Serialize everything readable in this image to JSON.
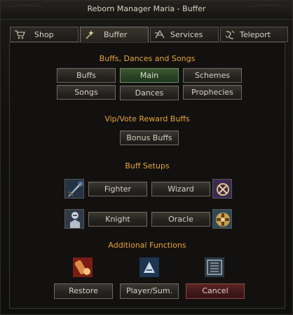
{
  "window": {
    "title": "Reborn Manager Maria - Buffer"
  },
  "tabs": [
    {
      "label": "Shop",
      "icon": "cart-icon"
    },
    {
      "label": "Buffer",
      "icon": "sparkle-icon"
    },
    {
      "label": "Services",
      "icon": "services-icon"
    },
    {
      "label": "Teleport",
      "icon": "teleport-icon"
    }
  ],
  "sections": {
    "buffs_title": "Buffs, Dances and Songs",
    "vip_title": "Vip/Vote Reward Buffs",
    "setups_title": "Buff Setups",
    "functions_title": "Additional Functions"
  },
  "buffs": {
    "buffs": "Buffs",
    "main": "Main",
    "schemes": "Schemes",
    "songs": "Songs",
    "dances": "Dances",
    "prophecies": "Prophecies"
  },
  "vip": {
    "bonus": "Bonus Buffs"
  },
  "setups": {
    "fighter": "Fighter",
    "wizard": "Wizard",
    "knight": "Knight",
    "oracle": "Oracle"
  },
  "functions": {
    "restore": "Restore",
    "player_sum": "Player/Sum.",
    "cancel": "Cancel"
  },
  "colors": {
    "section_title": "#e8a23c",
    "active_button": "#2a4224",
    "cancel_button": "#42191a"
  }
}
